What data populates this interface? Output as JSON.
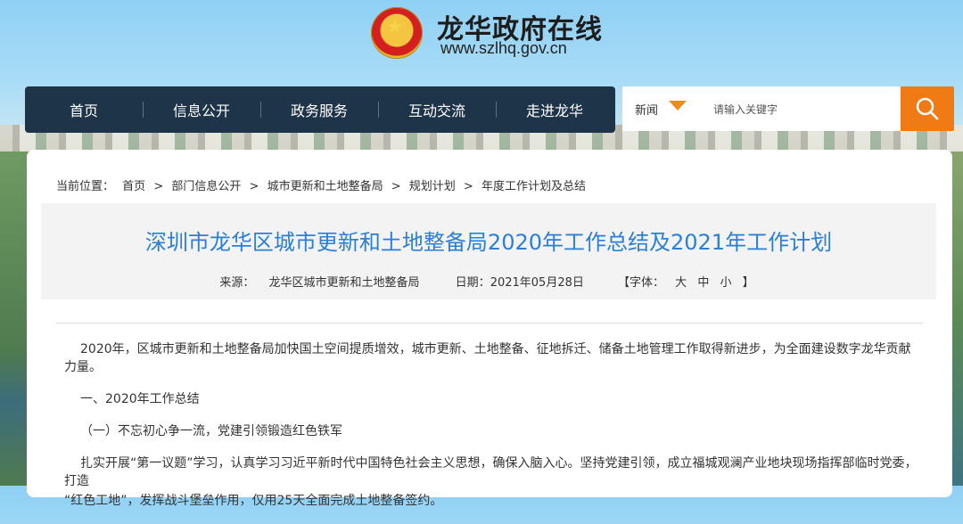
{
  "header": {
    "site_title": "龙华政府在线",
    "site_url": "www.szlhq.gov.cn",
    "emblem_icon": "national-emblem-icon"
  },
  "nav": {
    "items": [
      "首页",
      "信息公开",
      "政务服务",
      "互动交流",
      "走进龙华"
    ]
  },
  "search": {
    "category": "新闻",
    "placeholder": "请输入关键字",
    "button_icon": "search-icon"
  },
  "breadcrumb": {
    "prefix": "当前位置：",
    "items": [
      "首页",
      ">",
      "部门信息公开",
      ">",
      "城市更新和土地整备局",
      ">",
      "规划计划",
      ">",
      "年度工作计划及总结"
    ]
  },
  "article": {
    "title": "深圳市龙华区城市更新和土地整备局2020年工作总结及2021年工作计划",
    "source_label": "来源：",
    "source": "龙华区城市更新和土地整备局",
    "date_label": "日期：",
    "date": "2021年05月28日",
    "font_label": "【字体：",
    "font_sizes": [
      "大",
      "中",
      "小"
    ],
    "font_close": "】",
    "paragraphs": [
      "2020年，区城市更新和土地整备局加快国土空间提质增效，城市更新、土地整备、征地拆迁、储备土地管理工作取得新进步，为全面建设数字龙华贡献力量。",
      "一、2020年工作总结",
      "（一）不忘初心争一流，党建引领锻造红色铁军",
      "扎实开展“第一议题”学习，认真学习习近平新时代中国特色社会主义思想，确保入脑入心。坚持党建引领，成立福城观澜产业地块现场指挥部临时党委，打造",
      "“红色工地”，发挥战斗堡垒作用，仅用25天全面完成土地整备签约。"
    ]
  },
  "colors": {
    "nav_bg": "#1e3449",
    "accent_orange": "#f07b14",
    "title_blue": "#2b7fd6"
  }
}
